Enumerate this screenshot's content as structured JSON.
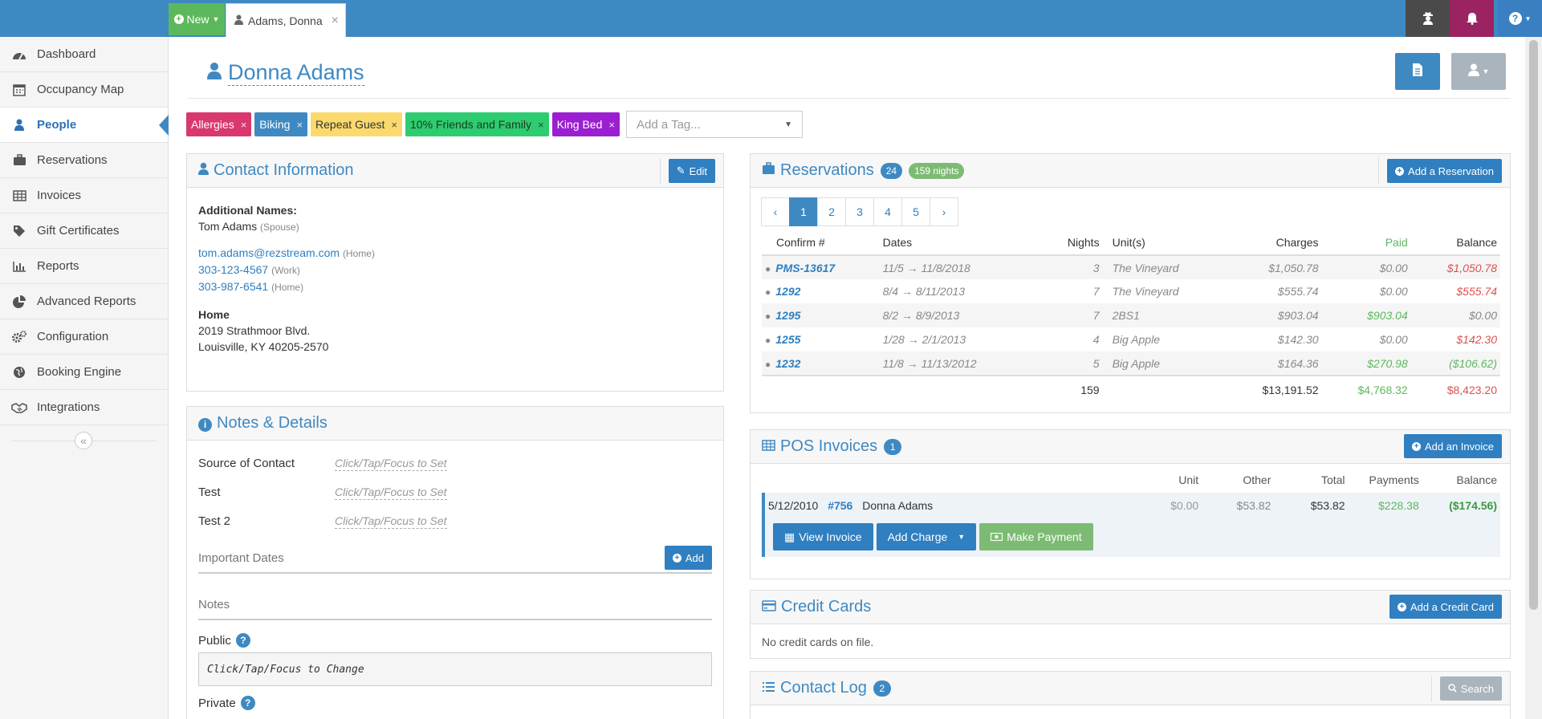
{
  "topbar": {
    "new_label": "New",
    "tab_label": "Adams, Donna",
    "icons": [
      "user-secret-icon",
      "bell-icon",
      "help-icon"
    ]
  },
  "sidebar": {
    "items": [
      {
        "label": "Dashboard",
        "icon": "dashboard-icon"
      },
      {
        "label": "Occupancy Map",
        "icon": "calendar-icon"
      },
      {
        "label": "People",
        "icon": "user-icon",
        "active": true
      },
      {
        "label": "Reservations",
        "icon": "suitcase-icon"
      },
      {
        "label": "Invoices",
        "icon": "table-icon"
      },
      {
        "label": "Gift Certificates",
        "icon": "tag-icon"
      },
      {
        "label": "Reports",
        "icon": "bar-chart-icon"
      },
      {
        "label": "Advanced Reports",
        "icon": "pie-chart-icon"
      },
      {
        "label": "Configuration",
        "icon": "cogs-icon"
      },
      {
        "label": "Booking Engine",
        "icon": "globe-icon"
      },
      {
        "label": "Integrations",
        "icon": "handshake-icon"
      }
    ]
  },
  "person": {
    "name": "Donna Adams"
  },
  "tags": {
    "items": [
      {
        "label": "Allergies",
        "color": "#d9386f"
      },
      {
        "label": "Biking",
        "color": "#3f89c2"
      },
      {
        "label": "Repeat Guest",
        "color": "#fbd96d"
      },
      {
        "label": "10% Friends and Family",
        "color": "#2ecc71"
      },
      {
        "label": "King Bed",
        "color": "#9b1fd1"
      }
    ],
    "placeholder": "Add a Tag..."
  },
  "contact": {
    "title": "Contact Information",
    "edit_label": "Edit",
    "additional_names_label": "Additional Names:",
    "additional_name": "Tom Adams",
    "additional_name_rel": "(Spouse)",
    "email": "tom.adams@rezstream.com",
    "email_type": "(Home)",
    "phone1": "303-123-4567",
    "phone1_type": "(Work)",
    "phone2": "303-987-6541",
    "phone2_type": "(Home)",
    "address_label": "Home",
    "address_line1": "2019 Strathmoor Blvd.",
    "address_line2": "Louisville, KY 40205-2570"
  },
  "notes": {
    "title": "Notes & Details",
    "fields": [
      {
        "label": "Source of Contact",
        "value": "Click/Tap/Focus to Set"
      },
      {
        "label": "Test",
        "value": "Click/Tap/Focus to Set"
      },
      {
        "label": "Test 2",
        "value": "Click/Tap/Focus to Set"
      }
    ],
    "important_dates_label": "Important Dates",
    "add_label": "Add",
    "notes_label": "Notes",
    "public_label": "Public",
    "public_value": "Click/Tap/Focus to Change",
    "private_label": "Private"
  },
  "reservations": {
    "title": "Reservations",
    "count_badge": "24",
    "nights_badge": "159 nights",
    "add_label": "Add a Reservation",
    "pages": [
      "‹",
      "1",
      "2",
      "3",
      "4",
      "5",
      "›"
    ],
    "columns": [
      "Confirm #",
      "Dates",
      "Nights",
      "Unit(s)",
      "Charges",
      "Paid",
      "Balance"
    ],
    "rows": [
      {
        "confirm": "PMS-13617",
        "dates": "11/5 → 11/8/2018",
        "nights": "3",
        "unit": "The Vineyard",
        "charges": "$1,050.78",
        "paid": "$0.00",
        "balance": "$1,050.78",
        "paid_color": "muted",
        "balance_color": "red"
      },
      {
        "confirm": "1292",
        "dates": "8/4 → 8/11/2013",
        "nights": "7",
        "unit": "The Vineyard",
        "charges": "$555.74",
        "paid": "$0.00",
        "balance": "$555.74",
        "paid_color": "muted",
        "balance_color": "red"
      },
      {
        "confirm": "1295",
        "dates": "8/2 → 8/9/2013",
        "nights": "7",
        "unit": "2BS1",
        "charges": "$903.04",
        "paid": "$903.04",
        "balance": "$0.00",
        "paid_color": "green",
        "balance_color": "muted"
      },
      {
        "confirm": "1255",
        "dates": "1/28 → 2/1/2013",
        "nights": "4",
        "unit": "Big Apple",
        "charges": "$142.30",
        "paid": "$0.00",
        "balance": "$142.30",
        "paid_color": "muted",
        "balance_color": "red"
      },
      {
        "confirm": "1232",
        "dates": "11/8 → 11/13/2012",
        "nights": "5",
        "unit": "Big Apple",
        "charges": "$164.36",
        "paid": "$270.98",
        "balance": "($106.62)",
        "paid_color": "green",
        "balance_color": "green"
      }
    ],
    "totals": {
      "nights": "159",
      "charges": "$13,191.52",
      "paid": "$4,768.32",
      "balance": "$8,423.20"
    }
  },
  "pos": {
    "title": "POS Invoices",
    "count_badge": "1",
    "add_label": "Add an Invoice",
    "columns": [
      "Unit",
      "Other",
      "Total",
      "Payments",
      "Balance"
    ],
    "row": {
      "date": "5/12/2010",
      "number": "#756",
      "name": "Donna Adams",
      "unit": "$0.00",
      "other": "$53.82",
      "total": "$53.82",
      "payments": "$228.38",
      "balance": "($174.56)"
    },
    "view_label": "View Invoice",
    "charge_label": "Add Charge",
    "payment_label": "Make Payment"
  },
  "cards": {
    "title": "Credit Cards",
    "add_label": "Add a Credit Card",
    "empty_text": "No credit cards on file."
  },
  "contact_log": {
    "title": "Contact Log",
    "count_badge": "2",
    "search_label": "Search"
  }
}
